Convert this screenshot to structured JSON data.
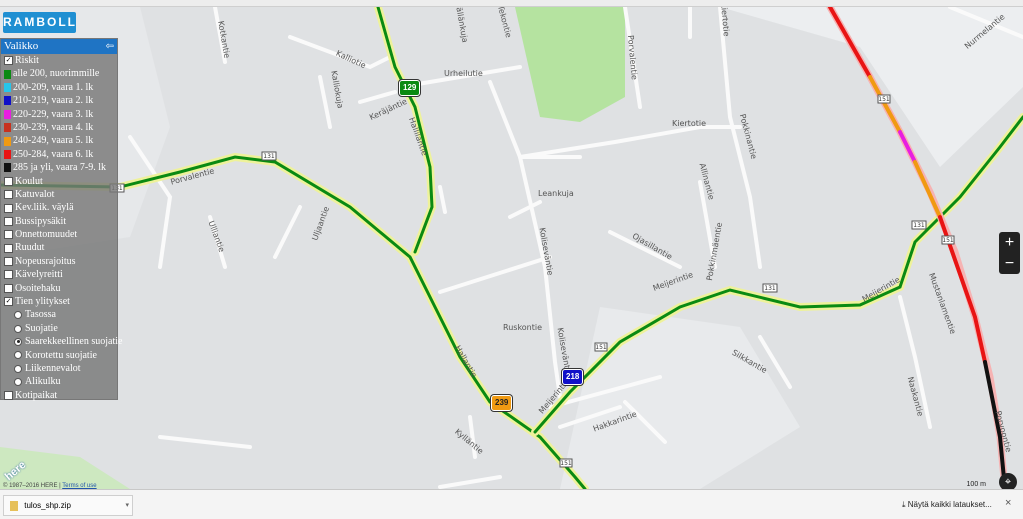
{
  "logo": "RAMBOLL",
  "menu": {
    "title": "Valikko",
    "collapse_icon": "⇦",
    "layers": [
      {
        "label": "Riskit",
        "checked": true
      },
      {
        "label": "alle 200, nuorimmille",
        "swatch": "#0a8a12"
      },
      {
        "label": "200-209, vaara 1. lk",
        "swatch": "#26c6ea"
      },
      {
        "label": "210-219, vaara 2. lk",
        "swatch": "#1010c8"
      },
      {
        "label": "220-229, vaara 3. lk",
        "swatch": "#e81ee0"
      },
      {
        "label": "230-239, vaara 4. lk",
        "swatch": "#c8321e"
      },
      {
        "label": "240-249, vaara 5. lk",
        "swatch": "#f09a12"
      },
      {
        "label": "250-284, vaara 6. lk",
        "swatch": "#e81414"
      },
      {
        "label": "285 ja yli, vaara 7-9. lk",
        "swatch": "#111111"
      },
      {
        "label": "Koulut",
        "checked": false
      },
      {
        "label": "Katuvalot",
        "checked": false
      },
      {
        "label": "Kev.liik. väylä",
        "checked": false
      },
      {
        "label": "Bussipysäkit",
        "checked": false
      },
      {
        "label": "Onnettomuudet",
        "checked": false
      },
      {
        "label": "Ruudut",
        "checked": false
      },
      {
        "label": "Nopeusrajoitus",
        "checked": false
      },
      {
        "label": "Kävelyreitti",
        "checked": false
      },
      {
        "label": "Osoitehaku",
        "checked": false
      },
      {
        "label": "Tien ylitykset",
        "checked": true
      },
      {
        "label": "Tasossa",
        "radio": true,
        "selected": false
      },
      {
        "label": "Suojatie",
        "radio": true,
        "selected": false
      },
      {
        "label": "Saarekkeellinen suojatie",
        "radio": true,
        "selected": true
      },
      {
        "label": "Korotettu suojatie",
        "radio": true,
        "selected": false
      },
      {
        "label": "Liikennevalot",
        "radio": true,
        "selected": false
      },
      {
        "label": "Alikulku",
        "radio": true,
        "selected": false
      },
      {
        "label": "Kotipaikat",
        "checked": false
      }
    ]
  },
  "streets": [
    "Kotkantie",
    "Kalliotie",
    "Kalliokuja",
    "Keräjäntie",
    "Urheilutie",
    "Hallilantie",
    "Mällänkuja",
    "Tekontie",
    "Kiertotie",
    "Pokkinantie",
    "Kiertotie",
    "Porvalentie",
    "Porvalentie",
    "Ulliantie",
    "Uljaantie",
    "Leankuja",
    "Koliseväntie",
    "Ojasillantie",
    "Allinantie",
    "Pokkinmäentie",
    "Meijerintie",
    "Meijerintie",
    "Hallantie",
    "Ruskontie",
    "Koliseväntie",
    "Silkkantie",
    "Meijerintie",
    "Hakkarintie",
    "Kylläntie",
    "Mustanlamentie",
    "Naakantie",
    "Nurmelantie",
    "Porvoontie"
  ],
  "road_numbers": [
    "129",
    "218",
    "239"
  ],
  "small_shields": [
    "131",
    "131",
    "151",
    "131",
    "151",
    "151",
    "131",
    "151"
  ],
  "zoom": {
    "plus": "+",
    "minus": "−"
  },
  "credit": {
    "copyright": "© 1987–2016 HERE |",
    "terms": "Terms of use",
    "brand": "here"
  },
  "scale": "100 m",
  "download": {
    "file": "tulos_shp.zip",
    "show_all": "Näytä kaikki lataukset...",
    "close": "×"
  },
  "colors": {
    "green": "#0a8a12",
    "orange": "#f09a12",
    "red": "#e81414",
    "blue": "#1010c8",
    "accent": "#1f74c4"
  }
}
